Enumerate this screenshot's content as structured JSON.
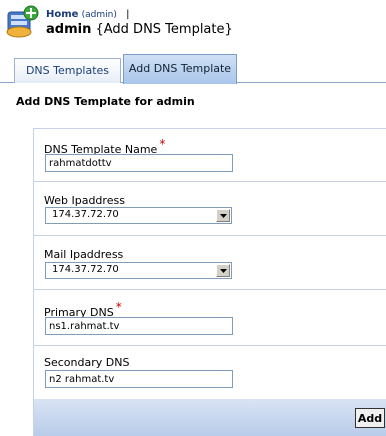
{
  "header": {
    "home_label": "Home",
    "home_user": "(admin)",
    "separator": "|",
    "user": "admin",
    "page_title": "{Add DNS Template}"
  },
  "tabs": [
    {
      "label": "DNS Templates",
      "active": false
    },
    {
      "label": "Add DNS Template",
      "active": true
    }
  ],
  "section_title": "Add DNS Template for admin",
  "form": {
    "template_name": {
      "label": "DNS Template Name",
      "required": "*",
      "value": "rahmatdottv"
    },
    "web_ip": {
      "label": "Web Ipaddress",
      "value": "174.37.72.70"
    },
    "mail_ip": {
      "label": "Mail Ipaddress",
      "value": "174.37.72.70"
    },
    "primary_dns": {
      "label": "Primary DNS",
      "required": "*",
      "value": "ns1.rahmat.tv"
    },
    "secondary_dns": {
      "label": "Secondary DNS",
      "value": "n2 rahmat.tv"
    },
    "add_label": "Add"
  },
  "colors": {
    "tab_text": "#1b3f7a",
    "required": "#cc0000",
    "footer": "#c6d6ee"
  }
}
